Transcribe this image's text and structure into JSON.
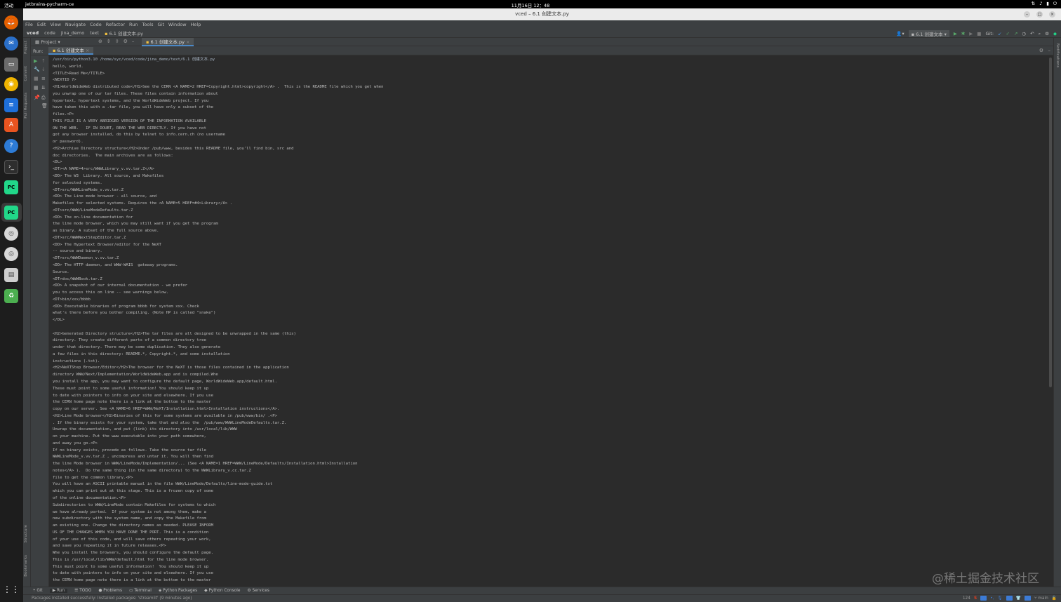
{
  "topbar": {
    "activities": "活动",
    "app_name": "jetbrains-pycharm-ce",
    "clock": "11月16日 12：48"
  },
  "window": {
    "title": "vced – 6.1 创建文本.py"
  },
  "menu": [
    "File",
    "Edit",
    "View",
    "Navigate",
    "Code",
    "Refactor",
    "Run",
    "Tools",
    "Git",
    "Window",
    "Help"
  ],
  "breadcrumb": [
    "vced",
    "code",
    "jina_demo",
    "text",
    "6.1 创建文本.py"
  ],
  "navbar_right": {
    "run_config": "6.1 创建文本",
    "git_label": "Git:"
  },
  "left_tabs": [
    "Project",
    "Commit",
    "Pull Requests",
    "Structure",
    "Bookmarks"
  ],
  "right_tabs": [
    "Notifications"
  ],
  "project_panel": {
    "label": "Project"
  },
  "editor_tab": "6.1 创建文本.py",
  "run": {
    "label": "Run:",
    "tab": "6.1 创建文本"
  },
  "console_lines": [
    "/usr/bin/python3.10 /home/syc/vced/code/jina_demo/text/6.1 创建文本.py",
    "hello, world.",
    "<TITLE>Read Me</TITLE>",
    "<NEXTID 7>",
    "<H1>WorldWideWeb distributed code</H1>See the CERN <A NAME=2 HREF=Copyright.html>copyright</A> .  This is the README file which you get when",
    "you unwrap one of our tar files. These files contain information about",
    "hypertext, hypertext systems, and the WorldWideWeb project. If you",
    "have taken this with a .tar file, you will have only a subset of the",
    "files.<P>",
    "THIS FILE IS A VERY ABRIDGED VERSION OF THE INFORMATION AVAILABLE",
    "ON THE WEB.   IF IN DOUBT, READ THE WEB DIRECTLY. If you have not",
    "got any browser installed, do this by telnet to info.cern.ch (no username",
    "or password).",
    "<H2>Archive Directory structure</H2>Under /pub/www, besides this README file, you'll find bin, src and",
    "doc directories.  The main archives are as follows:",
    "<DL>",
    "<DT><A NAME=4>src/WWWLibrary_v.vv.tar.Z</A>",
    "<DD> The W3  Library. All source, and Makefiles",
    "for selected systems.",
    "<DT>src/WWWLineMode_v.vv.tar.Z",
    "<DD> The Line mode browser - all source, and",
    "Makefiles for selected systems. Requires the <A NAME=5 HREF=#4>Library</A> .",
    "<DT>src/WWW/LineModeDefaults.tar.Z",
    "<DD> The on-line documentation for",
    "the line mode browser, which you may still want if you get the program",
    "as binary. A subset of the full source above.",
    "<DT>src/WWWNextStepEditor.tar.Z",
    "<DD> The Hypertext Browser/editor for the NeXT",
    "-- source and binary.",
    "<DT>src/WWWDaemon_v.vv.tar.Z",
    "<DD> The HTTP daemon, and WWW-WAIS  gateway programs.",
    "Source.",
    "<DT>doc/WWWBook.tar.Z",
    "<DD> A snapshot of our internal documentation - we prefer",
    "you to access this on line -- see warnings below.",
    "<DT>bin/xxx/bbbb",
    "<DD> Executable binaries of program bbbb for system xxx. Check",
    "what's there before you bother compiling. (Note HP is called \"snake\")",
    "</DL>",
    "",
    "<H2>Generated Directory structure</H2>The tar files are all designed to be unwrapped in the same (this)",
    "directory. They create different parts of a common directory tree",
    "under that directory. There may be some duplication. They also generate",
    "a few files in this directory: README.*, Copyright.*, and some installation",
    "instructions (.txt).",
    "<H2>NeXTStep Browser/Editor</H2>The browser for the NeXT is those files contained in the application",
    "directory WWW/Next/Implementation/WorldWideWeb.app and is compiled.Whe",
    "you install the app, you may want to configure the default page, WorldWideWeb.app/default.html.",
    "These must point to some useful information! You should keep it up",
    "to date with pointers to info on your site and elsewhere. If you use",
    "the CERN home page note there is a link at the bottom to the master",
    "copy on our server. See <A NAME=6 HREF=WWW/NeXT/Installation.html>Installation instructions</A>.",
    "<H2>Line Mode browser</H2>Binaries of this for some systems are available in /pub/www/bin/ .<P>",
    ". If the binary exists for your system, take that and also the  /pub/www/WWWLineModeDefaults.tar.Z.",
    "Unwrap the documentation, and put (link) its directory into /usr/local/lib/WWW",
    "on your machine. Put the www executable into your path somewhere,",
    "and away you go.<P>",
    "If no binary exists, procede as follows. Take the source tar file",
    "WWWLineMode_v.vv.tar.Z , uncompress and untar it. You will then find",
    "the line Mode browser in WWW/LineMode/Implementation/... (See <A NAME=1 HREF=WWW/LineMode/Defaults/Installation.html>Installation",
    "notes</A> ).  Do the same thing (in the same directory) to the WWWLibrary_v.cc.tar.Z",
    "file to get the common library.<P>",
    "You will have an ASCII printable manual in the file WWW/LineMode/Defaults/line-mode-guide.txt",
    "which you can print out at this stage. This is a frozen copy of some",
    "of the online documentation.<P>",
    "Subdirectories to WWW/LineMode contain Makefiles for systems to which",
    "we have already ported.  If your system is not among them, make a",
    "new subdirectory with the system name, and copy the Makefile from",
    "an existing one. Change the directory names as needed. PLEASE INFORM",
    "US OF THE CHANGES WHEN YOU HAVE DONE THE PORT. This is a condition",
    "of your use of this code, and will save others repeating your work,",
    "and save you repeating it in future releases.<P>",
    "Whe you install the browsers, you should configure the default page.",
    "This is /usr/local/lib/WWW/default.html for the line mode browser.",
    "This must point to some useful information!  You should keep it up",
    "to date with pointers to info on your site and elsewhere. If you use",
    "the CERN home page note there is a link at the bottom to the master"
  ],
  "bottom_tabs": [
    "Git",
    "Run",
    "TODO",
    "Problems",
    "Terminal",
    "Python Packages",
    "Python Console",
    "Services"
  ],
  "status": {
    "message": "Packages installed successfully: Installed packages: 'streamlit' (9 minutes ago)",
    "position": "124",
    "branch": "main"
  },
  "watermark": "@稀土掘金技术社区",
  "colors": {
    "console_bg": "#2b2b2b",
    "panel_bg": "#3c3f41",
    "console_text": "#bbbbbb",
    "accent_tab": "#4a88c7"
  }
}
